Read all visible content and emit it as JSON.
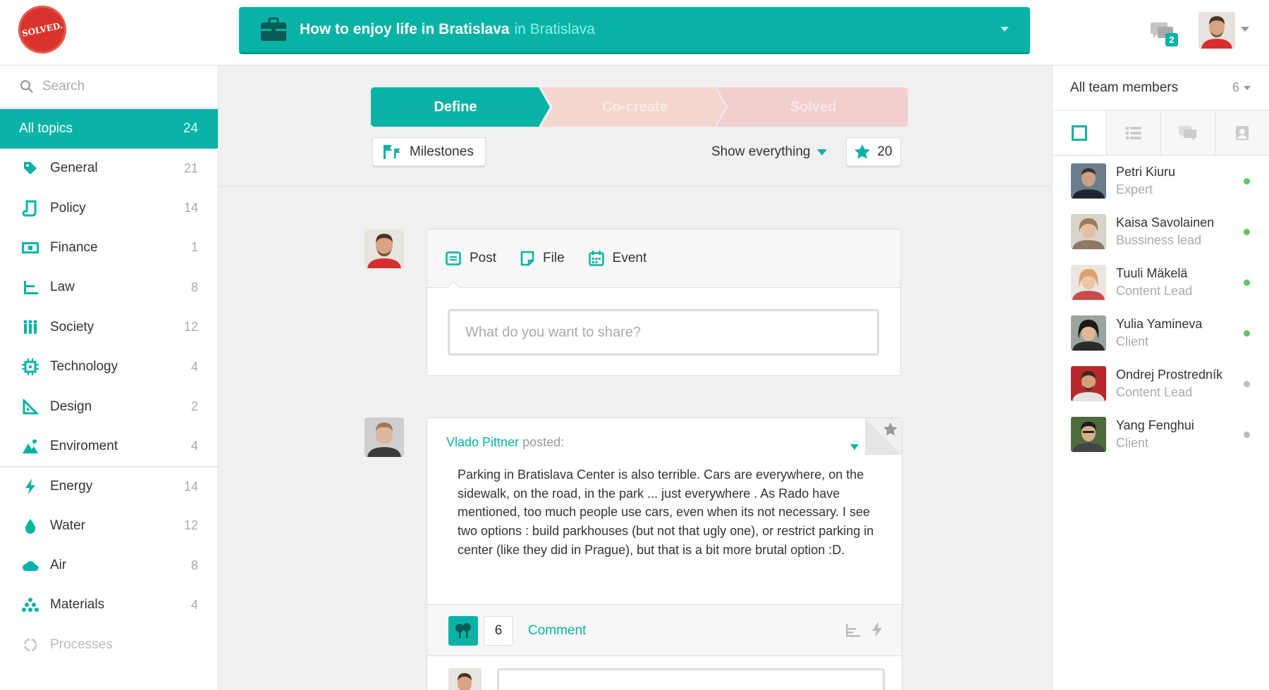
{
  "header": {
    "logo_text": "SOLVED.",
    "topic_title": "How to enjoy life in Bratislava",
    "topic_location": "in Bratislava",
    "chat_count": "2"
  },
  "sidebar": {
    "search_placeholder": "Search",
    "all_topics": {
      "label": "All topics",
      "count": "24"
    },
    "categories": [
      {
        "label": "General",
        "count": "21",
        "icon": "tag-icon"
      },
      {
        "label": "Policy",
        "count": "14",
        "icon": "policy-icon"
      },
      {
        "label": "Finance",
        "count": "1",
        "icon": "money-icon"
      },
      {
        "label": "Law",
        "count": "8",
        "icon": "law-icon"
      },
      {
        "label": "Society",
        "count": "12",
        "icon": "people-icon"
      },
      {
        "label": "Technology",
        "count": "4",
        "icon": "chip-icon"
      },
      {
        "label": "Design",
        "count": "2",
        "icon": "ruler-icon"
      },
      {
        "label": "Enviroment",
        "count": "4",
        "icon": "mountain-icon"
      },
      {
        "label": "Energy",
        "count": "14",
        "icon": "bolt-icon"
      },
      {
        "label": "Water",
        "count": "12",
        "icon": "drop-icon"
      },
      {
        "label": "Air",
        "count": "8",
        "icon": "cloud-icon"
      },
      {
        "label": "Materials",
        "count": "4",
        "icon": "materials-icon"
      },
      {
        "label": "Processes",
        "count": "",
        "icon": "recycle-icon"
      }
    ]
  },
  "progress": {
    "steps": [
      "Define",
      "Co-create",
      "Solved"
    ],
    "milestones_label": "Milestones",
    "filter_label": "Show everything",
    "star_count": "20"
  },
  "composer": {
    "tabs": [
      "Post",
      "File",
      "Event"
    ],
    "placeholder": "What do you want to share?"
  },
  "post": {
    "author": "Vlado Pittner",
    "action": "posted:",
    "body": "Parking in Bratislava Center is also terrible. Cars are everywhere, on the sidewalk, on the road, in the park ... just everywhere . As Rado have mentioned, too much people use cars, even when its not necessary. I see two options : build parkhouses (but not that ugly one), or restrict parking in center (like they did in Prague), but that is a bit more brutal option :D.",
    "likes": "6",
    "comment_label": "Comment"
  },
  "team": {
    "title": "All team members",
    "count": "6",
    "members": [
      {
        "name": "Petri Kiuru",
        "role": "Expert",
        "online": true
      },
      {
        "name": "Kaisa Savolainen",
        "role": "Bussiness lead",
        "online": true
      },
      {
        "name": "Tuuli Mäkelä",
        "role": "Content Lead",
        "online": true
      },
      {
        "name": "Yulia Yamineva",
        "role": "Client",
        "online": true
      },
      {
        "name": "Ondrej Prostredník",
        "role": "Content Lead",
        "online": false
      },
      {
        "name": "Yang Fenghui",
        "role": "Client",
        "online": false
      }
    ]
  },
  "colors": {
    "accent": "#08b3a6",
    "online": "#5cc85c",
    "offline": "#bbbbbb",
    "logo": "#d9342b"
  }
}
